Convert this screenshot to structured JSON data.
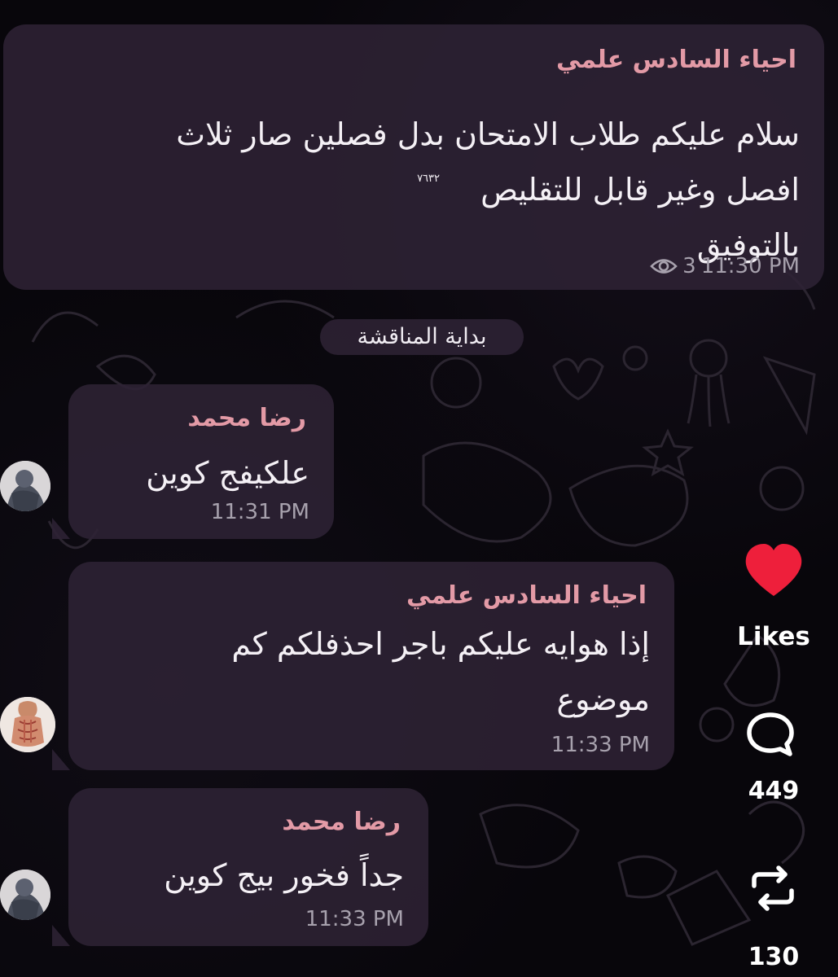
{
  "messages": [
    {
      "sender": "احياء السادس علمي",
      "lines": [
        "سلام عليكم طلاب الامتحان بدل فصلين صار ثلاث",
        "افصل وغير قابل للتقليص",
        "بالتوفيق"
      ],
      "superscript": "٣٢‏٧٦",
      "views": "3",
      "time": "11:30 PM"
    },
    {
      "sender": "رضا محمد",
      "lines": [
        "علكيفج كوين"
      ],
      "time": "11:31 PM"
    },
    {
      "sender": "احياء السادس علمي",
      "lines": [
        "إذا هوايه عليكم باجر احذفلكم كم",
        "موضوع"
      ],
      "time": "11:33 PM"
    },
    {
      "sender": "رضا محمد",
      "lines": [
        "جداً فخور بيج كوين"
      ],
      "time": "11:33 PM"
    }
  ],
  "date_divider": "بداية المناقشة",
  "side_actions": {
    "like_label": "Likes",
    "comments_count": "449",
    "reposts_count": "130"
  },
  "icons": {
    "like": "heart-icon",
    "comment": "speech-bubble-icon",
    "repost": "repost-arrows-icon",
    "views": "eye-icon"
  },
  "colors": {
    "sender_name": "#e39aa6",
    "heart": "#ee1f3b",
    "bubble": "#2e2234"
  }
}
